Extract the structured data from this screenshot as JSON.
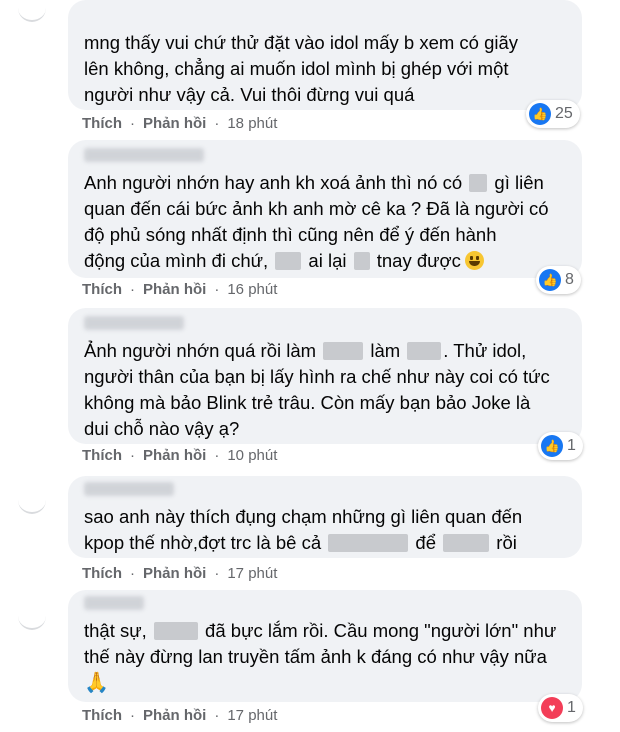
{
  "comments": [
    {
      "lines": [
        [
          "mng thấy vui chứ thử đặt vào idol mấy b xem có giãy"
        ],
        [
          "lên không, chẳng ai muốn idol mình bị ghép với một"
        ],
        [
          "người như vậy cả. Vui thôi đừng vui quá"
        ]
      ],
      "reaction": {
        "type": "like",
        "count": "25"
      },
      "actions": {
        "like": "Thích",
        "reply": "Phản hồi",
        "time": "18 phút"
      }
    },
    {
      "lines": [
        [
          "Anh người nhớn hay anh kh xoá ảnh thì nó có ",
          "[blur]",
          " gì liên"
        ],
        [
          "quan đến cái bức ảnh kh anh mờ cê ka ? Đã là người có"
        ],
        [
          "độ phủ sóng nhất định thì cũng nên để ý đến hành"
        ],
        [
          "động của mình đi chứ, ",
          "[blur]",
          " ai lại ",
          "[blur]",
          " tnay được",
          "[emoji]"
        ]
      ],
      "reaction": {
        "type": "like",
        "count": "8"
      },
      "actions": {
        "like": "Thích",
        "reply": "Phản hồi",
        "time": "16 phút"
      }
    },
    {
      "lines": [
        [
          "Ảnh người nhớn quá rồi làm ",
          "[blur]",
          " làm ",
          "[blur]",
          ". Thử idol,"
        ],
        [
          "người thân của bạn bị lấy hình ra chế như này coi có tức"
        ],
        [
          "không mà bảo Blink trẻ trâu. Còn mấy bạn bảo Joke là"
        ],
        [
          "dui chỗ nào vậy ạ?"
        ]
      ],
      "reaction": {
        "type": "like",
        "count": "1"
      },
      "actions": {
        "like": "Thích",
        "reply": "Phản hồi",
        "time": "10 phút"
      }
    },
    {
      "lines": [
        [
          "sao anh này thích đụng chạm những gì liên quan đến"
        ],
        [
          "kpop thế nhờ,đợt trc là bê cả ",
          "[blur]",
          " để ",
          "[blur]",
          " rồi"
        ]
      ],
      "reaction": null,
      "actions": {
        "like": "Thích",
        "reply": "Phản hồi",
        "time": "17 phút"
      }
    },
    {
      "lines": [
        [
          "thật sự, ",
          "[blur]",
          " đã bực lắm rồi. Cầu mong \"người lớn\" như"
        ],
        [
          "thế này đừng lan truyền tấm ảnh k đáng có như vậy nữa"
        ],
        [
          "[pray]"
        ]
      ],
      "reaction": {
        "type": "love",
        "count": "1"
      },
      "actions": {
        "like": "Thích",
        "reply": "Phản hồi",
        "time": "17 phút"
      }
    }
  ],
  "colors": {
    "bubble": "#f0f2f5",
    "text": "#050505",
    "meta": "#65676b",
    "like": "#1877f2",
    "love": "#f33e58"
  },
  "icons": {
    "like": "thumbs-up-icon",
    "love": "heart-icon",
    "smile": "grinning-face-emoji",
    "pray": "folded-hands-emoji"
  }
}
